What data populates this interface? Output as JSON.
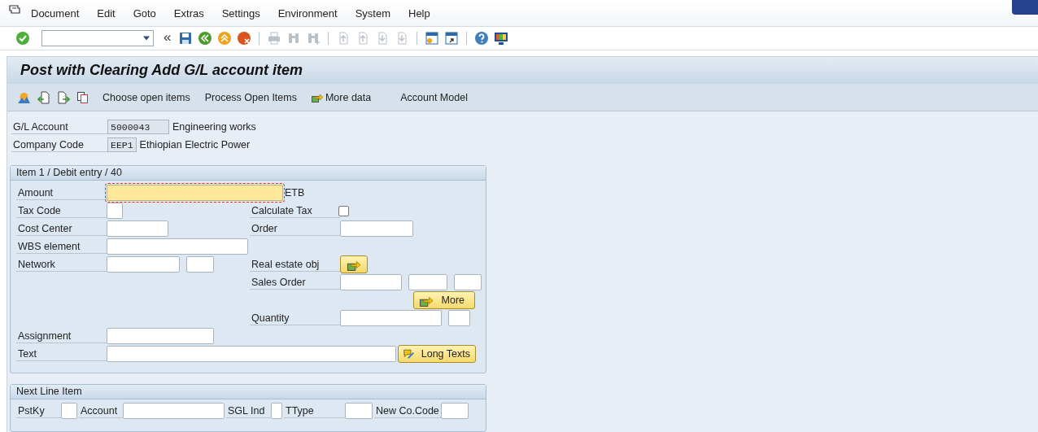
{
  "menu_bar": {
    "items": [
      "Document",
      "Edit",
      "Goto",
      "Extras",
      "Settings",
      "Environment",
      "System",
      "Help"
    ]
  },
  "toolbar": {
    "collapse_text": "«",
    "buttons": [
      {
        "kind": "save",
        "disabled": false
      },
      {
        "kind": "back",
        "disabled": false
      },
      {
        "kind": "exit",
        "disabled": false
      },
      {
        "kind": "cancel",
        "disabled": false
      },
      {
        "kind": "print",
        "disabled": true
      },
      {
        "kind": "find",
        "disabled": true
      },
      {
        "kind": "find-next",
        "disabled": true
      },
      {
        "kind": "first",
        "disabled": true
      },
      {
        "kind": "prev",
        "disabled": true
      },
      {
        "kind": "next",
        "disabled": true
      },
      {
        "kind": "last",
        "disabled": true
      },
      {
        "kind": "new-session",
        "disabled": false
      },
      {
        "kind": "shortcut",
        "disabled": false
      },
      {
        "kind": "help",
        "disabled": false
      },
      {
        "kind": "layout",
        "disabled": false
      }
    ]
  },
  "title": "Post with Clearing Add G/L account item",
  "app_toolbar": {
    "icon_buttons": [
      {
        "kind": "overview"
      },
      {
        "kind": "previous"
      },
      {
        "kind": "next"
      },
      {
        "kind": "copy"
      }
    ],
    "buttons": [
      {
        "label": "Choose open items",
        "icon": false
      },
      {
        "label": "Process Open Items",
        "icon": false
      },
      {
        "label": "More data",
        "icon": true
      },
      {
        "label": "Account Model",
        "icon": false
      }
    ]
  },
  "header": [
    {
      "label": "G/L Account",
      "value": "5000043",
      "description": "Engineering works"
    },
    {
      "label": "Company Code",
      "value": "EEP1",
      "description": "Ethiopian Electric Power"
    }
  ],
  "item_section": {
    "title": "Item 1 / Debit entry / 40",
    "rows": [
      {
        "left": {
          "label": "Amount",
          "fields": [
            {
              "kind": "amount",
              "required": true
            }
          ],
          "unit": "ETB"
        }
      },
      {
        "left": {
          "label": "Tax Code",
          "fields": [
            {
              "kind": "xs",
              "required": false
            }
          ]
        },
        "right": {
          "label": "Calculate Tax",
          "checkbox": {
            "checked": false
          }
        }
      },
      {
        "left": {
          "label": "Cost Center",
          "fields": [
            {
              "kind": "l",
              "required": false
            }
          ]
        },
        "right": {
          "label": "Order",
          "fields": [
            {
              "kind": "xl",
              "required": false
            }
          ]
        }
      },
      {
        "left": {
          "label": "WBS element",
          "fields": [
            {
              "kind": "ww",
              "required": false
            }
          ]
        }
      },
      {
        "left": {
          "label": "Network",
          "fields": [
            {
              "kind": "xl",
              "required": false
            },
            {
              "kind": "s",
              "required": false
            }
          ]
        },
        "right": {
          "label": "Real estate obj",
          "button": {
            "kind": "icon"
          }
        }
      },
      {
        "right": {
          "label": "Sales Order",
          "fields": [
            {
              "kind": "l",
              "required": false
            },
            {
              "kind": "m",
              "required": false
            },
            {
              "kind": "s",
              "required": false
            }
          ]
        }
      },
      {
        "right": {
          "button": {
            "kind": "text",
            "label": "More"
          }
        }
      },
      {
        "right": {
          "label": "Quantity",
          "fields": [
            {
              "kind": "xxl",
              "required": false
            },
            {
              "kind": "sm",
              "required": false
            }
          ]
        }
      },
      {
        "left": {
          "label": "Assignment",
          "fields": [
            {
              "kind": "w",
              "required": false
            }
          ]
        }
      },
      {
        "left": {
          "label": "Text",
          "fields": [
            {
              "kind": "full",
              "required": false
            }
          ],
          "long_texts": "Long Texts"
        }
      }
    ]
  },
  "next_line_item": {
    "title": "Next Line Item",
    "fields": [
      {
        "label": "PstKy",
        "kind": "xs"
      },
      {
        "label": "Account",
        "kind": "xxl"
      },
      {
        "label": "SGL Ind",
        "kind": "xxs"
      },
      {
        "label": "TType",
        "kind": "s"
      },
      {
        "label": "New Co.Code",
        "kind": "s"
      }
    ]
  }
}
